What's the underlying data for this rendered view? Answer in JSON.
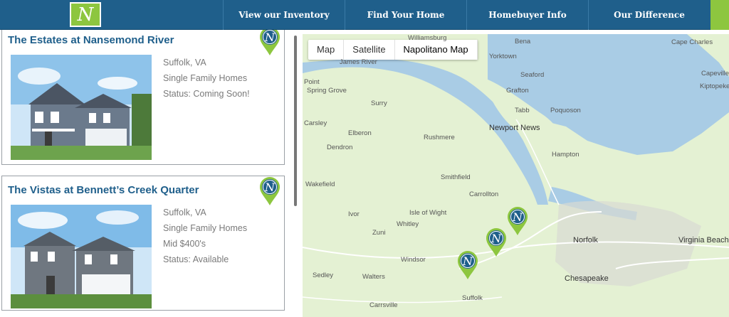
{
  "brand": {
    "logo_letter": "N"
  },
  "nav": {
    "items": [
      {
        "label": "View our Inventory"
      },
      {
        "label": "Find Your Home"
      },
      {
        "label": "Homebuyer Info"
      },
      {
        "label": "Our Difference"
      }
    ]
  },
  "listings": [
    {
      "title": "The Estates at Nansemond River",
      "pin_letter": "N",
      "details": [
        "Suffolk, VA",
        "Single Family Homes",
        "Status: Coming Soon!"
      ]
    },
    {
      "title": "The Vistas at Bennett’s Creek Quarter",
      "pin_letter": "N",
      "details": [
        "Suffolk, VA",
        "Single Family Homes",
        "Mid $400's",
        "Status: Available"
      ]
    }
  ],
  "map": {
    "tabs": [
      {
        "label": "Map"
      },
      {
        "label": "Satellite"
      },
      {
        "label": "Napolitano Map"
      }
    ],
    "active_tab": "Napolitano Map",
    "places": [
      "Williamsburg",
      "Bena",
      "Cape Charles",
      "James River",
      "Yorktown",
      "Capeville",
      "Seaford",
      "Kiptopeke",
      "Point",
      "Spring Grove",
      "Grafton",
      "Surry",
      "Tabb",
      "Poquoson",
      "Carsley",
      "Newport News",
      "Elberon",
      "Rushmere",
      "Hampton",
      "Dendron",
      "Smithfield",
      "Wakefield",
      "Carrollton",
      "Isle of Wight",
      "Ivor",
      "Whitley",
      "Zuni",
      "Norfolk",
      "Virginia Beach",
      "Windsor",
      "Sedley",
      "Walters",
      "Chesapeake",
      "Suffolk",
      "Carrsville"
    ]
  },
  "colors": {
    "header": "#1f5f8b",
    "accent": "#8dc63f",
    "title": "#1f5f8b"
  }
}
